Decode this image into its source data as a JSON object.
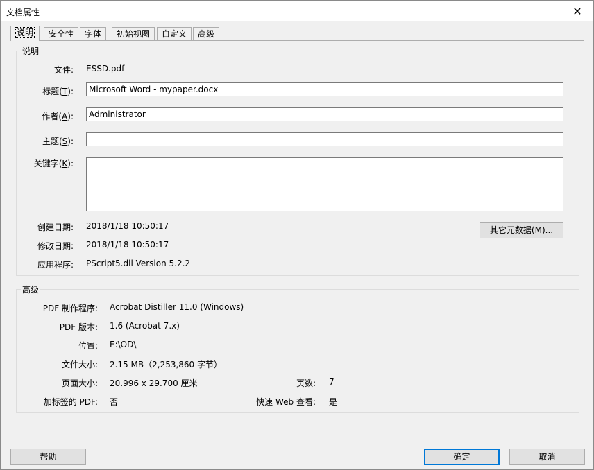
{
  "window": {
    "title": "文档属性",
    "close_symbol": "✕"
  },
  "tabs": [
    "说明",
    "安全性",
    "字体",
    "初始视图",
    "自定义",
    "高级"
  ],
  "description_group": {
    "title": "说明",
    "file_label": "文件:",
    "file_value": "ESSD.pdf",
    "title_label_pre": "标题(",
    "title_label_key": "T",
    "title_label_post": "):",
    "title_value": "Microsoft Word - mypaper.docx",
    "author_label_pre": "作者(",
    "author_label_key": "A",
    "author_label_post": "):",
    "author_value": "Administrator",
    "subject_label_pre": "主题(",
    "subject_label_key": "S",
    "subject_label_post": "):",
    "subject_value": "",
    "keywords_label_pre": "关键字(",
    "keywords_label_key": "K",
    "keywords_label_post": "):",
    "keywords_value": "",
    "created_label": "创建日期:",
    "created_value": "2018/1/18 10:50:17",
    "modified_label": "修改日期:",
    "modified_value": "2018/1/18 10:50:17",
    "application_label": "应用程序:",
    "application_value": "PScript5.dll Version 5.2.2",
    "metadata_button_pre": "其它元数据(",
    "metadata_button_key": "M",
    "metadata_button_post": ")..."
  },
  "advanced_group": {
    "title": "高级",
    "producer_label": "PDF 制作程序:",
    "producer_value": "Acrobat Distiller 11.0 (Windows)",
    "version_label": "PDF 版本:",
    "version_value": "1.6 (Acrobat 7.x)",
    "location_label": "位置:",
    "location_value": "E:\\OD\\",
    "filesize_label": "文件大小:",
    "filesize_value": "2.15 MB（2,253,860 字节）",
    "pagesize_label": "页面大小:",
    "pagesize_value": "20.996 x 29.700 厘米",
    "pages_label": "页数:",
    "pages_value": "7",
    "tagged_label": "加标签的 PDF:",
    "tagged_value": "否",
    "fastweb_label": "快速 Web 查看:",
    "fastweb_value": "是"
  },
  "buttons": {
    "help": "帮助",
    "ok": "确定",
    "cancel": "取消"
  }
}
